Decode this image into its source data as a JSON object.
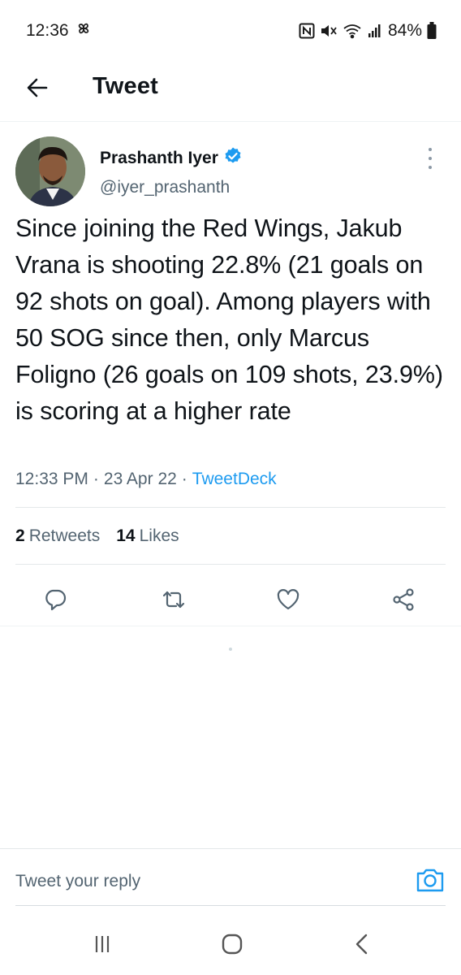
{
  "status_bar": {
    "time": "12:36",
    "battery": "84%"
  },
  "header": {
    "title": "Tweet",
    "back_icon": "arrow-left-icon"
  },
  "tweet": {
    "author_name": "Prashanth Iyer",
    "author_handle": "@iyer_prashanth",
    "verified": true,
    "text": "Since joining the Red Wings, Jakub Vrana is shooting 22.8% (21 goals on 92 shots on goal). Among players with 50 SOG since then, only Marcus Foligno (26 goals on 109 shots, 23.9%) is scoring at a higher rate",
    "time": "12:33 PM",
    "separator": "·",
    "date": "23 Apr 22",
    "source": "TweetDeck",
    "retweets_count": "2",
    "retweets_label": "Retweets",
    "likes_count": "14",
    "likes_label": "Likes"
  },
  "actions": [
    "reply-icon",
    "retweet-icon",
    "like-icon",
    "share-icon"
  ],
  "reply_bar": {
    "placeholder": "Tweet your reply",
    "camera_icon": "camera-icon"
  },
  "colors": {
    "accent": "#1d9bf0",
    "secondary_text": "#536471",
    "primary_text": "#0f1419"
  }
}
